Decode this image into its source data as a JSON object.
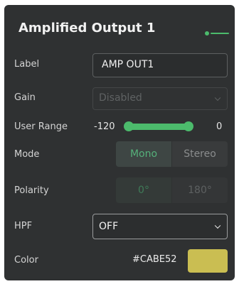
{
  "panel": {
    "title": "Amplified Output 1",
    "status_color": "#4cbb6c"
  },
  "label_row": {
    "label": "Label",
    "value": "AMP OUT1"
  },
  "gain_row": {
    "label": "Gain",
    "value": "Disabled",
    "disabled": true
  },
  "user_range_row": {
    "label": "User Range",
    "min_text": "-120",
    "max_text": "0",
    "low_fraction": 0.0,
    "high_fraction": 1.0,
    "fill_color": "#4cbb6c"
  },
  "mode_row": {
    "label": "Mode",
    "options": [
      "Mono",
      "Stereo"
    ],
    "selected": "Mono"
  },
  "polarity_row": {
    "label": "Polarity",
    "options": [
      "0°",
      "180°"
    ],
    "selected": "0°",
    "disabled": true
  },
  "hpf_row": {
    "label": "HPF",
    "value": "OFF"
  },
  "color_row": {
    "label": "Color",
    "hex": "#CABE52",
    "swatch_color": "#cabe52"
  }
}
